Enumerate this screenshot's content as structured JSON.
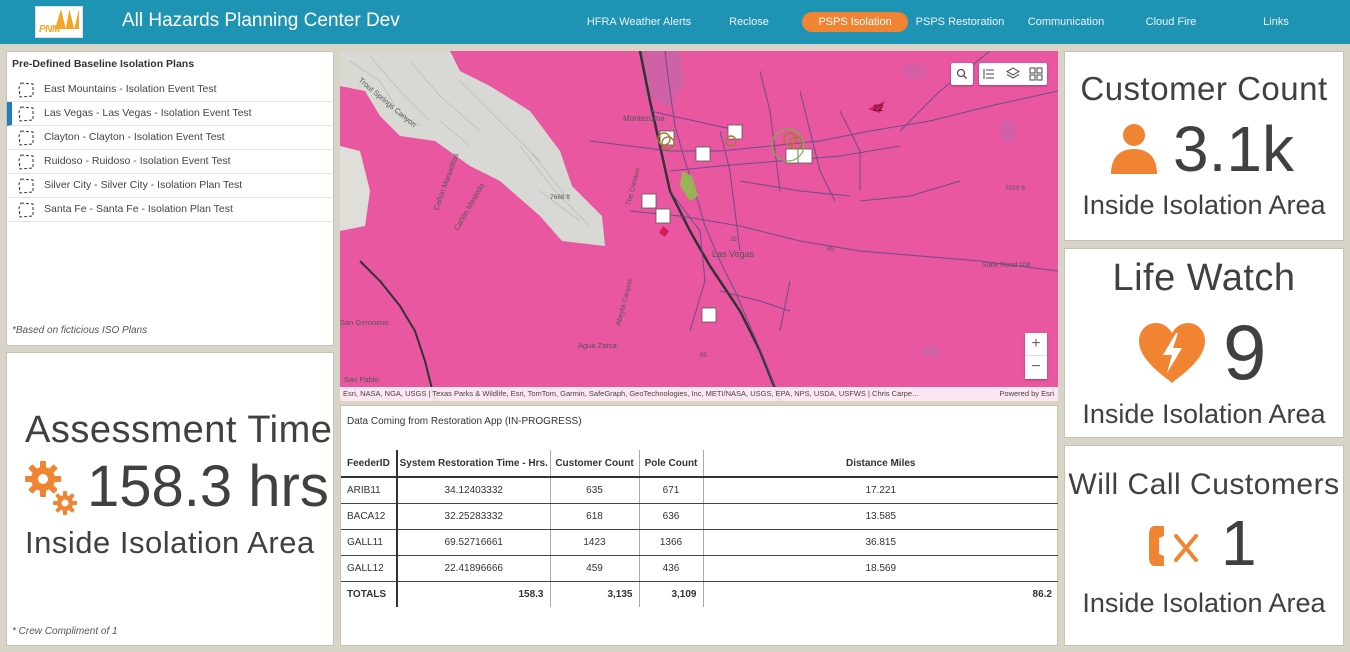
{
  "header": {
    "logo_text": "PNM",
    "title": "All Hazards Planning Center Dev",
    "nav": [
      {
        "label": "HFRA Weather Alerts",
        "active": false
      },
      {
        "label": "Reclose",
        "active": false
      },
      {
        "label": "PSPS Isolation",
        "active": true
      },
      {
        "label": "PSPS Restoration",
        "active": false
      },
      {
        "label": "Communication",
        "active": false
      },
      {
        "label": "Cloud Fire",
        "active": false
      },
      {
        "label": "Links",
        "active": false
      }
    ]
  },
  "plans": {
    "title": "Pre-Defined Baseline Isolation Plans",
    "items": [
      "East Mountains - Isolation Event Test",
      "Las Vegas - Las Vegas - Isolation Event Test",
      "Clayton - Clayton - Isolation Event Test",
      "Ruidoso - Ruidoso - Isolation Event Test",
      "Silver City - Silver City - Isolation Plan Test",
      "Santa Fe - Santa Fe - Isolation Plan Test"
    ],
    "selected_index": 1,
    "note": "*Based on ficticious ISO Plans"
  },
  "assessment": {
    "title": "Assessment Time",
    "value": "158.3 hrs",
    "subtitle": "Inside Isolation Area",
    "note": "* Crew Compliment of 1",
    "icon": "gears-icon"
  },
  "map": {
    "labels": {
      "trout": "Trout Springs Canyon",
      "montezuma": "Montezuma",
      "vegas": "Las Vegas",
      "creston": "The Creston",
      "canon_manuelitas": "Cañón Manuelitas",
      "canon_mestedo": "Cañón Mestedo",
      "san_geronimo": "San Geronimo",
      "agua_zarca": "Agua Zarca",
      "abeyta": "Abeyta Canyon",
      "state_road": "State Road 104",
      "san_pablo": "San Pablo",
      "num22": "22",
      "elev1": "7688 ft",
      "elev2": "7029 ft",
      "hwy25": "25",
      "hwy85": "85",
      "hwy65": "65"
    },
    "attribution": "Esri, NASA, NGA, USGS | Texas Parks & Wildlife, Esri, TomTom, Garmin, SafeGraph, GeoTechnologies, Inc, METI/NASA, USGS, EPA, NPS, USDA, USFWS | Chris Carpe...",
    "powered_by": "Powered by Esri",
    "zoom_in": "+",
    "zoom_out": "−",
    "colors": {
      "isolation": "#e8579f",
      "terrain": "#d9d9d9"
    }
  },
  "restoration": {
    "caption": "Data Coming from Restoration App (IN-PROGRESS)",
    "columns": [
      "FeederID",
      "System Restoration Time - Hrs.",
      "Customer Count",
      "Pole Count",
      "Distance Miles"
    ],
    "rows": [
      [
        "ARIB11",
        "34.12403332",
        "635",
        "671",
        "17.221"
      ],
      [
        "BACA12",
        "32.25283332",
        "618",
        "636",
        "13.585"
      ],
      [
        "GALL11",
        "69.52716661",
        "1423",
        "1366",
        "36.815"
      ],
      [
        "GALL12",
        "22.41896666",
        "459",
        "436",
        "18.569"
      ]
    ],
    "totals": [
      "TOTALS",
      "158.3",
      "3,135",
      "3,109",
      "86.2"
    ]
  },
  "stats": [
    {
      "title": "Customer Count",
      "value": "3.1k",
      "subtitle": "Inside Isolation Area",
      "icon": "person-icon"
    },
    {
      "title": "Life Watch",
      "value": "9",
      "subtitle": "Inside Isolation Area",
      "icon": "heart-bolt-icon"
    },
    {
      "title": "Will Call Customers",
      "value": "1",
      "subtitle": "Inside Isolation Area",
      "icon": "phone-x-icon"
    }
  ],
  "accent": "#f08432"
}
